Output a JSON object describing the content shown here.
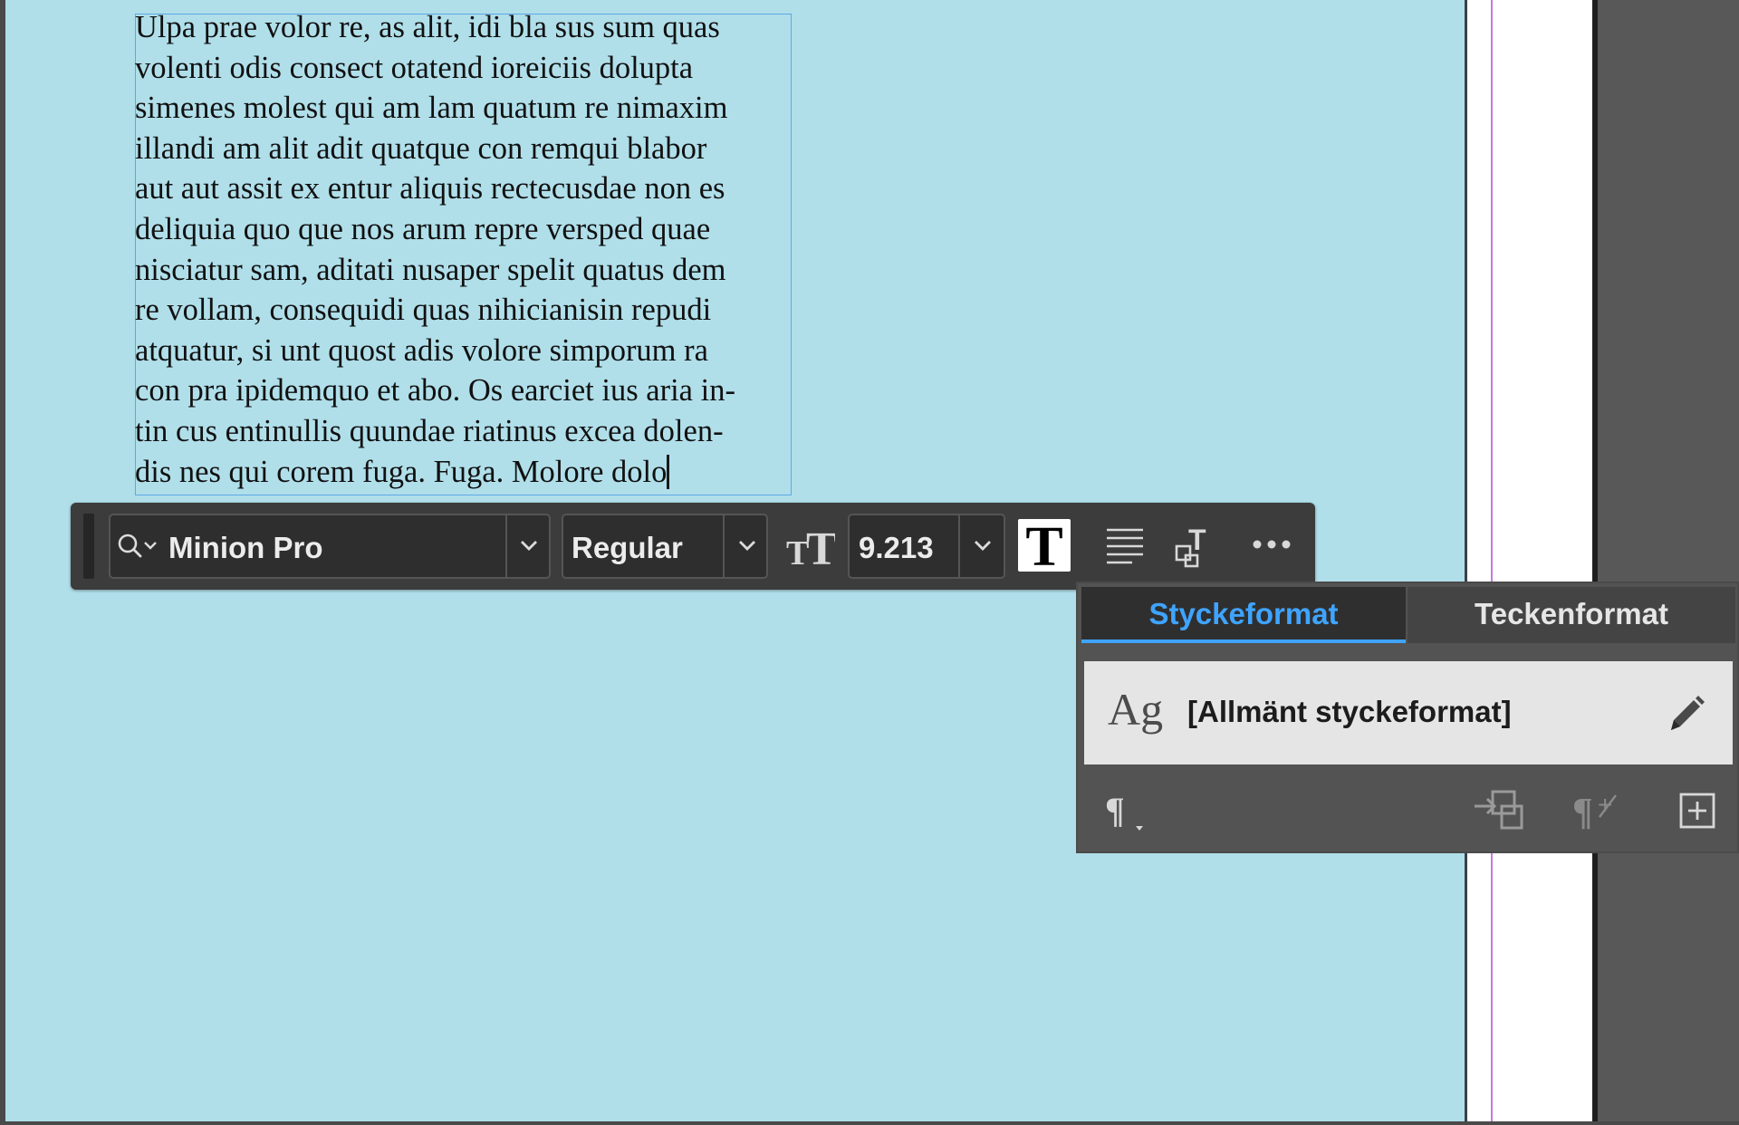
{
  "document": {
    "story_lines": [
      "Ulpa prae volor re, as alit, idi bla sus sum quas",
      "volenti odis consect otatend ioreiciis dolupta",
      "simenes molest qui am lam quatum re nimaxim",
      "illandi am alit adit quatque con remqui blabor",
      "aut aut assit ex entur aliquis rectecusdae non es",
      "deliquia quo que nos arum repre versped quae",
      "nisciatur sam, aditati nusaper spelit quatus dem",
      "re vollam, consequidi quas nihicianisin repudi",
      "atquatur, si unt quost adis volore simporum ra",
      "con pra ipidemquo et abo. Os earciet ius aria in-",
      "tin cus entinullis quundae riatinus excea dolen-",
      "dis nes qui corem fuga. Fuga. Molore dolo"
    ]
  },
  "context_bar": {
    "font_family": "Minion Pro",
    "font_style": "Regular",
    "font_size": "9.213",
    "icons": [
      "search-icon",
      "font-size-icon",
      "character-formatting-icon",
      "align-justify-icon",
      "frame-fitting-icon",
      "more-options-icon"
    ]
  },
  "styles_panel": {
    "tabs": [
      {
        "label": "Styckeformat",
        "active": true
      },
      {
        "label": "Teckenformat",
        "active": false
      }
    ],
    "current_style": {
      "preview": "Ag",
      "name": "[Allmänt styckeformat]"
    },
    "footer_icons": [
      "paragraph-menu-icon",
      "apply-style-icon",
      "clear-overrides-icon",
      "new-style-icon"
    ]
  },
  "colors": {
    "page": "#b0dfea",
    "pasteboard": "#585858",
    "toolbar": "#3c3c3c",
    "accent": "#3fa4ff",
    "margin_guide": "#c77bd8",
    "frame_edge": "#5ea8e6"
  }
}
